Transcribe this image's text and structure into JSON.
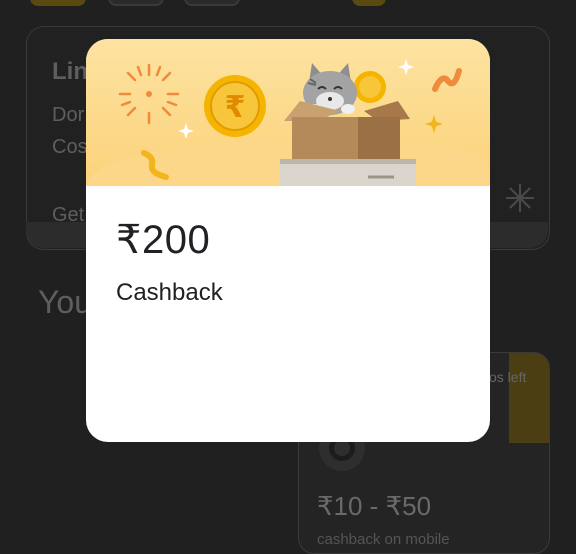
{
  "background": {
    "limited_card": {
      "title_partial": "Lin",
      "line1_partial": "Dor",
      "line2_partial": "Cos",
      "cta_partial": "Get"
    },
    "section_title_partial": "You",
    "offer_card": {
      "badge_partial": "os left",
      "amount": "₹10 - ₹50",
      "subtitle_partial": "cashback on mobile"
    }
  },
  "reward_modal": {
    "amount": "₹200",
    "label": "Cashback"
  },
  "colors": {
    "banner_yellow": "#fbd27a",
    "coin_gold": "#f3b51c",
    "box_brown": "#b58a5a",
    "overlay_dark": "#202020"
  },
  "icons": [
    "fireworks-icon",
    "rupee-coin-icon",
    "cat-in-box-illustration",
    "sparkle-icon",
    "confetti-icon"
  ]
}
